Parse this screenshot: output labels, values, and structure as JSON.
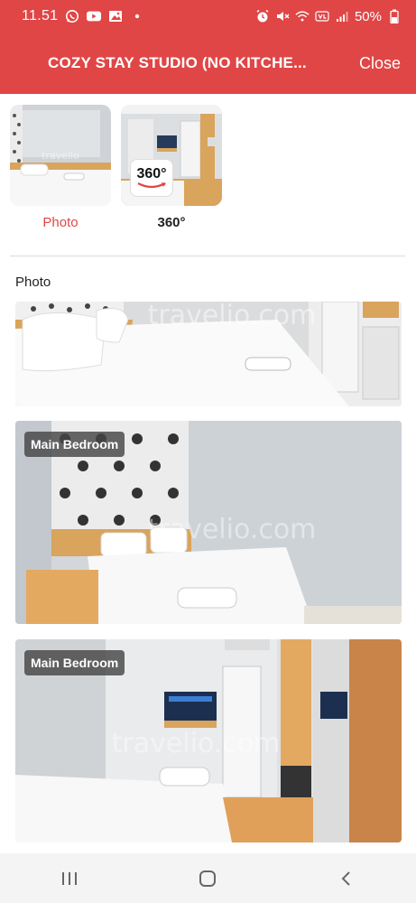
{
  "status_bar": {
    "time": "11.51",
    "battery": "50%",
    "icons": [
      "whatsapp-icon",
      "youtube-icon",
      "gallery-icon",
      "dot-icon",
      "alarm-icon",
      "mute-icon",
      "wifi-icon",
      "volte-icon",
      "signal-icon",
      "battery-icon"
    ]
  },
  "app_bar": {
    "title": "COZY STAY STUDIO (NO KITCHE...",
    "close_label": "Close"
  },
  "categories": [
    {
      "label": "Photo",
      "active": true
    },
    {
      "label": "360°",
      "active": false,
      "badge": "360°"
    }
  ],
  "section": {
    "title": "Photo"
  },
  "photos": [
    {
      "badge": ""
    },
    {
      "badge": "Main Bedroom"
    },
    {
      "badge": "Main Bedroom"
    }
  ],
  "watermark": "travelio.com",
  "nav_bar": {
    "icons": [
      "recent-apps-icon",
      "home-icon",
      "back-icon"
    ]
  },
  "colors": {
    "accent": "#e04646",
    "active_label": "#e04646"
  }
}
